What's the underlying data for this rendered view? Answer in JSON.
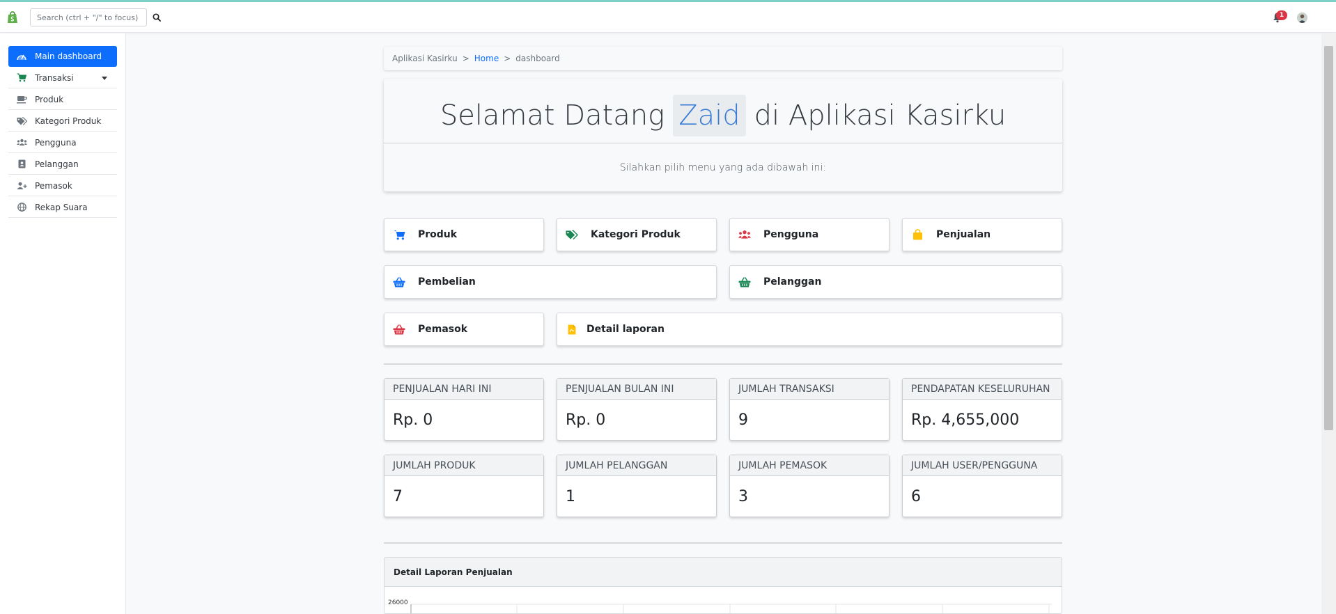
{
  "topbar": {
    "search_placeholder": "Search (ctrl + \"/\" to focus)",
    "notification_count": "1"
  },
  "sidebar": {
    "items": [
      {
        "label": "Main dashboard",
        "icon": "dashboard-icon"
      },
      {
        "label": "Transaksi",
        "icon": "cart-icon"
      },
      {
        "label": "Produk",
        "icon": "coffee-icon"
      },
      {
        "label": "Kategori Produk",
        "icon": "tags-icon"
      },
      {
        "label": "Pengguna",
        "icon": "users-icon"
      },
      {
        "label": "Pelanggan",
        "icon": "id-badge-icon"
      },
      {
        "label": "Pemasok",
        "icon": "user-plus-icon"
      },
      {
        "label": "Rekap Suara",
        "icon": "globe-icon"
      }
    ]
  },
  "breadcrumb": {
    "root": "Aplikasi Kasirku",
    "home": "Home",
    "current": "dashboard"
  },
  "hero": {
    "greeting": "Selamat Datang",
    "name": "Zaid",
    "app": "di Aplikasi Kasirku",
    "subtitle": "Silahkan pilih menu yang ada dibawah ini:"
  },
  "menu": [
    {
      "label": "Produk",
      "icon": "cart-icon",
      "color": "#0d6efd"
    },
    {
      "label": "Kategori Produk",
      "icon": "tags-icon",
      "color": "#198754"
    },
    {
      "label": "Pengguna",
      "icon": "users-icon",
      "color": "#dc3545"
    },
    {
      "label": "Penjualan",
      "icon": "shopping-bag-icon",
      "color": "#ffc107"
    },
    {
      "label": "Pembelian",
      "icon": "basket-icon",
      "color": "#0d6efd"
    },
    {
      "label": "Pelanggan",
      "icon": "basket-icon",
      "color": "#198754"
    },
    {
      "label": "Pemasok",
      "icon": "basket-icon",
      "color": "#dc3545"
    },
    {
      "label": "Detail laporan",
      "icon": "file-pdf-icon",
      "color": "#ffc107"
    }
  ],
  "stats": [
    {
      "label": "PENJUALAN HARI INI",
      "value": "Rp. 0"
    },
    {
      "label": "PENJUALAN BULAN INI",
      "value": "Rp. 0"
    },
    {
      "label": "JUMLAH TRANSAKSI",
      "value": "9"
    },
    {
      "label": "PENDAPATAN KESELURUHAN",
      "value": "Rp. 4,655,000"
    },
    {
      "label": "JUMLAH PRODUK",
      "value": "7"
    },
    {
      "label": "JUMLAH PELANGGAN",
      "value": "1"
    },
    {
      "label": "JUMLAH PEMASOK",
      "value": "3"
    },
    {
      "label": "JUMLAH USER/PENGGUNA",
      "value": "6"
    }
  ],
  "report": {
    "title": "Detail Laporan Penjualan",
    "y_tick_top": "26000"
  }
}
